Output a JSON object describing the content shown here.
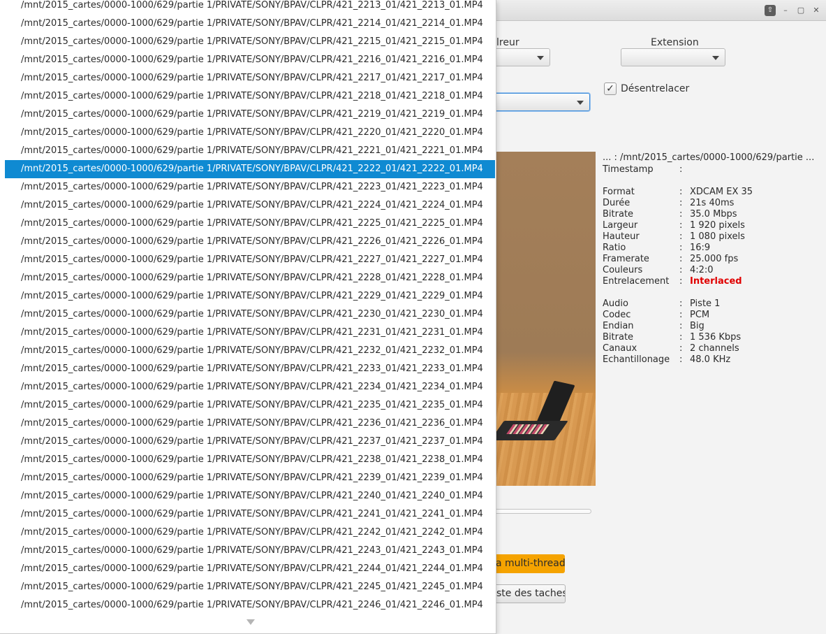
{
  "form": {
    "couleur_label_fragment": "lreur",
    "extension_label": "Extension",
    "desentrelacer_label": "Désentrelacer",
    "desentrelacer_checked": true
  },
  "buttons": {
    "multithread_label_fragment": "a multi-thread",
    "tasklist_label_fragment": "ste des taches"
  },
  "info": {
    "path": "...  :  /mnt/2015_cartes/0000-1000/629/partie ...",
    "rows": [
      {
        "key": "Timestamp",
        "value": ""
      },
      {
        "key": "Format",
        "value": "XDCAM EX 35"
      },
      {
        "key": "Durée",
        "value": "21s 40ms"
      },
      {
        "key": "Bitrate",
        "value": "35.0 Mbps"
      },
      {
        "key": "Largeur",
        "value": "1 920 pixels"
      },
      {
        "key": "Hauteur",
        "value": "1 080 pixels"
      },
      {
        "key": "Ratio",
        "value": "16:9"
      },
      {
        "key": "Framerate",
        "value": "25.000 fps"
      },
      {
        "key": "Couleurs",
        "value": "4:2:0"
      },
      {
        "key": "Entrelacement",
        "value": "Interlaced"
      },
      {
        "key": "Audio",
        "value": "Piste 1"
      },
      {
        "key": "Codec",
        "value": "PCM"
      },
      {
        "key": "Endian",
        "value": "Big"
      },
      {
        "key": "Bitrate",
        "value": "1 536 Kbps"
      },
      {
        "key": "Canaux",
        "value": "2 channels"
      },
      {
        "key": "Echantillonage",
        "value": "48.0 KHz"
      }
    ],
    "separator": ":"
  },
  "colors": {
    "selection": "#0f8ad2",
    "accent_button": "#f5a300",
    "interlaced": "#e00000"
  },
  "file_list": {
    "selected_index": 9,
    "items": [
      "/mnt/2015_cartes/0000-1000/629/partie 1/PRIVATE/SONY/BPAV/CLPR/421_2213_01/421_2213_01.MP4",
      "/mnt/2015_cartes/0000-1000/629/partie 1/PRIVATE/SONY/BPAV/CLPR/421_2214_01/421_2214_01.MP4",
      "/mnt/2015_cartes/0000-1000/629/partie 1/PRIVATE/SONY/BPAV/CLPR/421_2215_01/421_2215_01.MP4",
      "/mnt/2015_cartes/0000-1000/629/partie 1/PRIVATE/SONY/BPAV/CLPR/421_2216_01/421_2216_01.MP4",
      "/mnt/2015_cartes/0000-1000/629/partie 1/PRIVATE/SONY/BPAV/CLPR/421_2217_01/421_2217_01.MP4",
      "/mnt/2015_cartes/0000-1000/629/partie 1/PRIVATE/SONY/BPAV/CLPR/421_2218_01/421_2218_01.MP4",
      "/mnt/2015_cartes/0000-1000/629/partie 1/PRIVATE/SONY/BPAV/CLPR/421_2219_01/421_2219_01.MP4",
      "/mnt/2015_cartes/0000-1000/629/partie 1/PRIVATE/SONY/BPAV/CLPR/421_2220_01/421_2220_01.MP4",
      "/mnt/2015_cartes/0000-1000/629/partie 1/PRIVATE/SONY/BPAV/CLPR/421_2221_01/421_2221_01.MP4",
      "/mnt/2015_cartes/0000-1000/629/partie 1/PRIVATE/SONY/BPAV/CLPR/421_2222_01/421_2222_01.MP4",
      "/mnt/2015_cartes/0000-1000/629/partie 1/PRIVATE/SONY/BPAV/CLPR/421_2223_01/421_2223_01.MP4",
      "/mnt/2015_cartes/0000-1000/629/partie 1/PRIVATE/SONY/BPAV/CLPR/421_2224_01/421_2224_01.MP4",
      "/mnt/2015_cartes/0000-1000/629/partie 1/PRIVATE/SONY/BPAV/CLPR/421_2225_01/421_2225_01.MP4",
      "/mnt/2015_cartes/0000-1000/629/partie 1/PRIVATE/SONY/BPAV/CLPR/421_2226_01/421_2226_01.MP4",
      "/mnt/2015_cartes/0000-1000/629/partie 1/PRIVATE/SONY/BPAV/CLPR/421_2227_01/421_2227_01.MP4",
      "/mnt/2015_cartes/0000-1000/629/partie 1/PRIVATE/SONY/BPAV/CLPR/421_2228_01/421_2228_01.MP4",
      "/mnt/2015_cartes/0000-1000/629/partie 1/PRIVATE/SONY/BPAV/CLPR/421_2229_01/421_2229_01.MP4",
      "/mnt/2015_cartes/0000-1000/629/partie 1/PRIVATE/SONY/BPAV/CLPR/421_2230_01/421_2230_01.MP4",
      "/mnt/2015_cartes/0000-1000/629/partie 1/PRIVATE/SONY/BPAV/CLPR/421_2231_01/421_2231_01.MP4",
      "/mnt/2015_cartes/0000-1000/629/partie 1/PRIVATE/SONY/BPAV/CLPR/421_2232_01/421_2232_01.MP4",
      "/mnt/2015_cartes/0000-1000/629/partie 1/PRIVATE/SONY/BPAV/CLPR/421_2233_01/421_2233_01.MP4",
      "/mnt/2015_cartes/0000-1000/629/partie 1/PRIVATE/SONY/BPAV/CLPR/421_2234_01/421_2234_01.MP4",
      "/mnt/2015_cartes/0000-1000/629/partie 1/PRIVATE/SONY/BPAV/CLPR/421_2235_01/421_2235_01.MP4",
      "/mnt/2015_cartes/0000-1000/629/partie 1/PRIVATE/SONY/BPAV/CLPR/421_2236_01/421_2236_01.MP4",
      "/mnt/2015_cartes/0000-1000/629/partie 1/PRIVATE/SONY/BPAV/CLPR/421_2237_01/421_2237_01.MP4",
      "/mnt/2015_cartes/0000-1000/629/partie 1/PRIVATE/SONY/BPAV/CLPR/421_2238_01/421_2238_01.MP4",
      "/mnt/2015_cartes/0000-1000/629/partie 1/PRIVATE/SONY/BPAV/CLPR/421_2239_01/421_2239_01.MP4",
      "/mnt/2015_cartes/0000-1000/629/partie 1/PRIVATE/SONY/BPAV/CLPR/421_2240_01/421_2240_01.MP4",
      "/mnt/2015_cartes/0000-1000/629/partie 1/PRIVATE/SONY/BPAV/CLPR/421_2241_01/421_2241_01.MP4",
      "/mnt/2015_cartes/0000-1000/629/partie 1/PRIVATE/SONY/BPAV/CLPR/421_2242_01/421_2242_01.MP4",
      "/mnt/2015_cartes/0000-1000/629/partie 1/PRIVATE/SONY/BPAV/CLPR/421_2243_01/421_2243_01.MP4",
      "/mnt/2015_cartes/0000-1000/629/partie 1/PRIVATE/SONY/BPAV/CLPR/421_2244_01/421_2244_01.MP4",
      "/mnt/2015_cartes/0000-1000/629/partie 1/PRIVATE/SONY/BPAV/CLPR/421_2245_01/421_2245_01.MP4",
      "/mnt/2015_cartes/0000-1000/629/partie 1/PRIVATE/SONY/BPAV/CLPR/421_2246_01/421_2246_01.MP4"
    ]
  }
}
